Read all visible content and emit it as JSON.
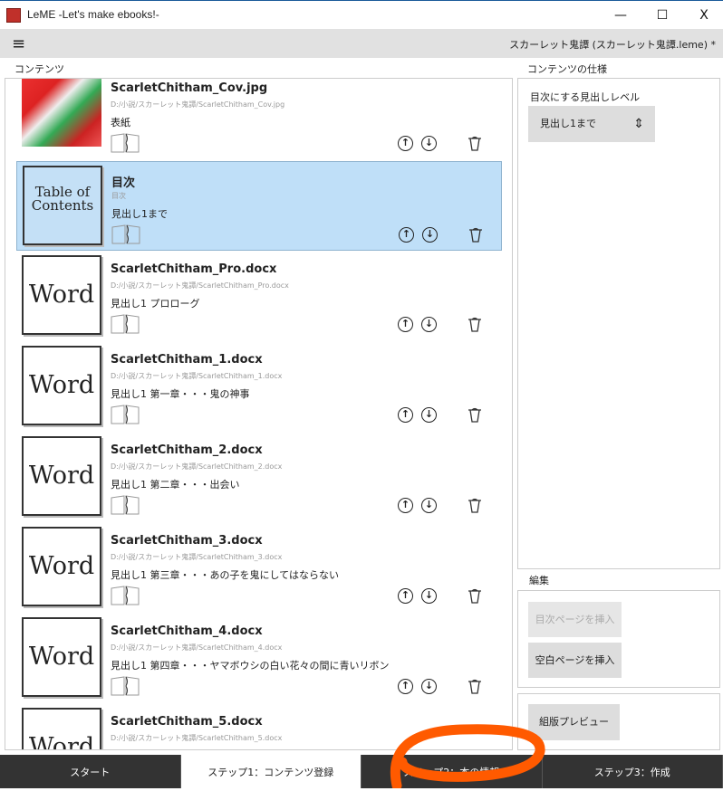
{
  "window": {
    "title": "LeME -Let's make ebooks!-",
    "minimize": "—",
    "maximize": "☐",
    "close": "X"
  },
  "toolbar": {
    "menu_icon": "≡",
    "document_title": "スカーレット鬼譚 (スカーレット鬼譚.leme) *"
  },
  "contents": {
    "label": "コンテンツ",
    "items": [
      {
        "name": "ScarletChitham_Cov.jpg",
        "path": "D:/小説/スカーレット鬼譚/ScarletChitham_Cov.jpg",
        "heading": "表紙",
        "thumb": "cover",
        "thumb_text": ""
      },
      {
        "name": "目次",
        "path": "目次",
        "heading": "見出し1まで",
        "thumb": "toc",
        "thumb_text": "Table of Contents",
        "selected": true
      },
      {
        "name": "ScarletChitham_Pro.docx",
        "path": "D:/小説/スカーレット鬼譚/ScarletChitham_Pro.docx",
        "heading": "見出し1 プロローグ",
        "thumb": "word",
        "thumb_text": "Word"
      },
      {
        "name": "ScarletChitham_1.docx",
        "path": "D:/小説/スカーレット鬼譚/ScarletChitham_1.docx",
        "heading": "見出し1 第一章・・・鬼の神事",
        "thumb": "word",
        "thumb_text": "Word"
      },
      {
        "name": "ScarletChitham_2.docx",
        "path": "D:/小説/スカーレット鬼譚/ScarletChitham_2.docx",
        "heading": "見出し1 第二章・・・出会い",
        "thumb": "word",
        "thumb_text": "Word"
      },
      {
        "name": "ScarletChitham_3.docx",
        "path": "D:/小説/スカーレット鬼譚/ScarletChitham_3.docx",
        "heading": "見出し1 第三章・・・あの子を鬼にしてはならない",
        "thumb": "word",
        "thumb_text": "Word"
      },
      {
        "name": "ScarletChitham_4.docx",
        "path": "D:/小説/スカーレット鬼譚/ScarletChitham_4.docx",
        "heading": "見出し1 第四章・・・ヤマボウシの白い花々の間に青いリボン",
        "thumb": "word",
        "thumb_text": "Word"
      },
      {
        "name": "ScarletChitham_5.docx",
        "path": "D:/小説/スカーレット鬼譚/ScarletChitham_5.docx",
        "heading": "",
        "thumb": "word",
        "thumb_text": "Word"
      }
    ],
    "up_icon": "↑",
    "down_icon": "↓"
  },
  "spec": {
    "label": "コンテンツの仕様",
    "toc_level_label": "目次にする見出しレベル",
    "toc_level_value": "見出し1まで"
  },
  "edit": {
    "label": "編集",
    "insert_toc": "目次ページを挿入",
    "insert_blank": "空白ページを挿入"
  },
  "preview": {
    "button": "組版プレビュー"
  },
  "steps": [
    {
      "label": "スタート"
    },
    {
      "label": "ステップ1：コンテンツ登録",
      "active": true
    },
    {
      "label": "ステップ2：本の情報"
    },
    {
      "label": "ステップ3：作成"
    }
  ],
  "colors": {
    "selection": "#bfdff8",
    "step_bar": "#333333",
    "annotation": "#ff5a00"
  }
}
